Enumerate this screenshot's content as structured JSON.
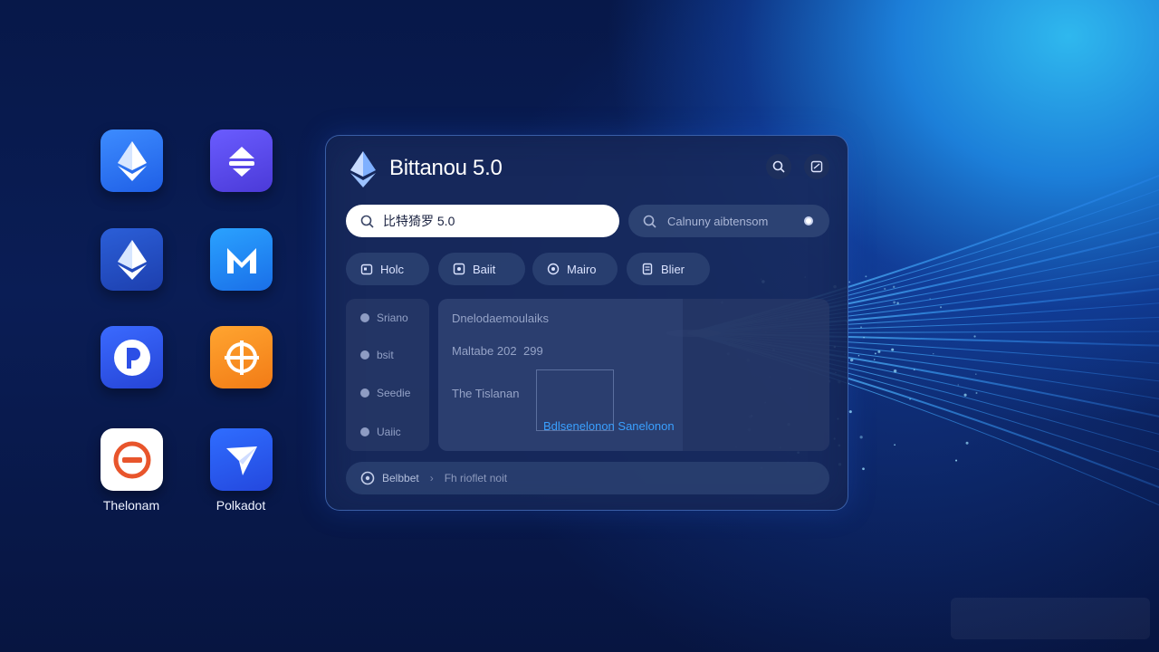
{
  "apps": [
    {
      "name": "ethereum",
      "label": ""
    },
    {
      "name": "arrow-app",
      "label": ""
    },
    {
      "name": "ethereum-dark",
      "label": ""
    },
    {
      "name": "m-app",
      "label": ""
    },
    {
      "name": "p-app",
      "label": ""
    },
    {
      "name": "target-app",
      "label": ""
    },
    {
      "name": "minus-app",
      "label": "Thelonam"
    },
    {
      "name": "send-app",
      "label": "Polkadot"
    }
  ],
  "panel": {
    "title": "Bittanou 5.0",
    "search_value": "比特猗罗 5.0",
    "search2_text": "Calnuny aibtensom",
    "chips": [
      {
        "icon": "calendar-icon",
        "label": "Holc"
      },
      {
        "icon": "image-icon",
        "label": "Baiit"
      },
      {
        "icon": "gear-icon",
        "label": "Mairo"
      },
      {
        "icon": "document-icon",
        "label": "Blier"
      }
    ],
    "side_items": [
      "Sriano",
      "bsit",
      "Seedie",
      "Uaiic"
    ],
    "content": {
      "line1": "Dnelodaemoulaiks",
      "line2a": "Maltabe 202",
      "line2b": "299",
      "line3": "The Tislanan",
      "link": "Bdlsenelonon Sanelonon"
    },
    "footer": {
      "label": "Belbbet",
      "separator": "›",
      "text": "Fh rioflet noit"
    }
  },
  "colors": {
    "accent": "#3aa0ff",
    "panel_border": "#5a8ce6",
    "background_dark": "#071849",
    "background_glow": "#2fb8ee"
  }
}
